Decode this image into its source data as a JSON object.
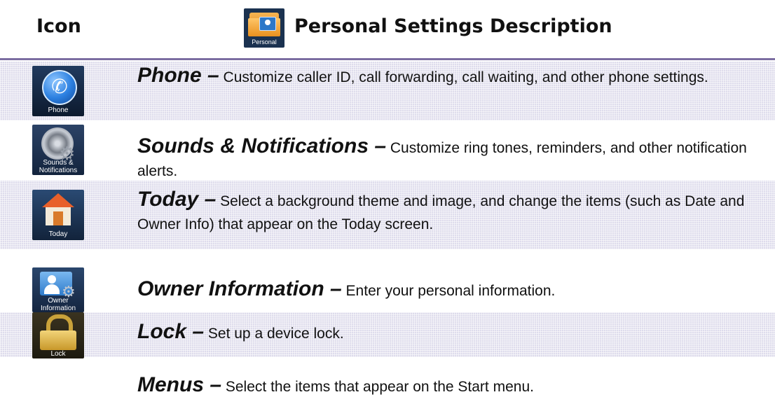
{
  "header": {
    "icon_col": "Icon",
    "folder_label": "Personal",
    "title": "Personal Settings Description"
  },
  "rows": [
    {
      "icon_label": "Phone",
      "name": "Phone –",
      "desc": "Customize caller ID, call forwarding, call waiting, and other phone settings."
    },
    {
      "icon_label": "Sounds & Notifications",
      "name": "Sounds & Notifications –",
      "desc": "Customize ring tones, reminders, and other notification alerts."
    },
    {
      "icon_label": "Today",
      "name": "Today –",
      "desc": "Select a background theme and image, and change the items (such as Date and Owner Info) that appear on the Today screen."
    },
    {
      "icon_label": "Owner Information",
      "name": "Owner Information –",
      "desc": "Enter your personal information."
    },
    {
      "icon_label": "Lock",
      "name": "Lock –",
      "desc": "Set up a device lock."
    },
    {
      "icon_label": "",
      "name": "Menus –",
      "desc": "Select the items that appear on the Start menu."
    }
  ],
  "icons": [
    "phone-icon",
    "sounds-notifications-icon",
    "today-icon",
    "owner-information-icon",
    "lock-icon",
    "personal-folder-icon"
  ],
  "colors": {
    "header_rule": "#7c6ea2",
    "row_shade": "#dedcec"
  }
}
